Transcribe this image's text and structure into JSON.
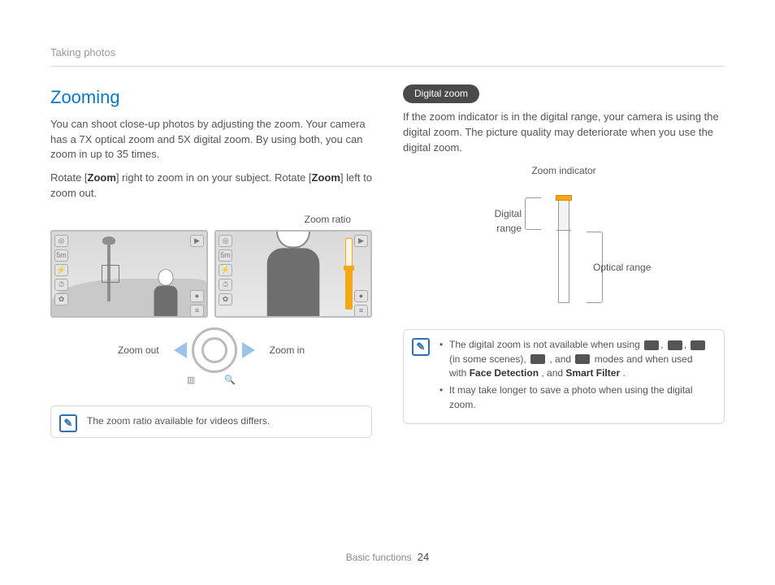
{
  "breadcrumb": "Taking photos",
  "title": "Zooming",
  "intro": "You can shoot close-up photos by adjusting the zoom. Your camera has a 7X optical zoom and 5X digital zoom. By using both, you can zoom in up to 35 times.",
  "rotate_pre": "Rotate [",
  "zoom_word": "Zoom",
  "rotate_mid1": "] right to zoom in on your subject. Rotate [",
  "rotate_mid2": "] left to zoom out.",
  "zoom_ratio_label": "Zoom ratio",
  "zoom_out_label": "Zoom out",
  "zoom_in_label": "Zoom in",
  "note_left": "The zoom ratio available for videos differs.",
  "digital_zoom_pill": "Digital zoom",
  "digital_zoom_text": "If the zoom indicator is in the digital range, your camera is using the digital zoom. The picture quality may deteriorate when you use the digital zoom.",
  "zoom_indicator_label": "Zoom indicator",
  "digital_range_label": "Digital range",
  "optical_range_label": "Optical range",
  "note_r1_a": "The digital zoom is not available when using ",
  "note_r1_b": " (in some scenes), ",
  "note_r1_c": ", and ",
  "note_r1_d": " modes and when used with ",
  "face_detection": "Face Detection",
  "note_r1_e": ", and ",
  "smart_filter": "Smart Filter",
  "note_r1_f": ".",
  "note_r2": "It may take longer to save a photo when using the digital zoom.",
  "footer_section": "Basic functions",
  "page_number": "24"
}
